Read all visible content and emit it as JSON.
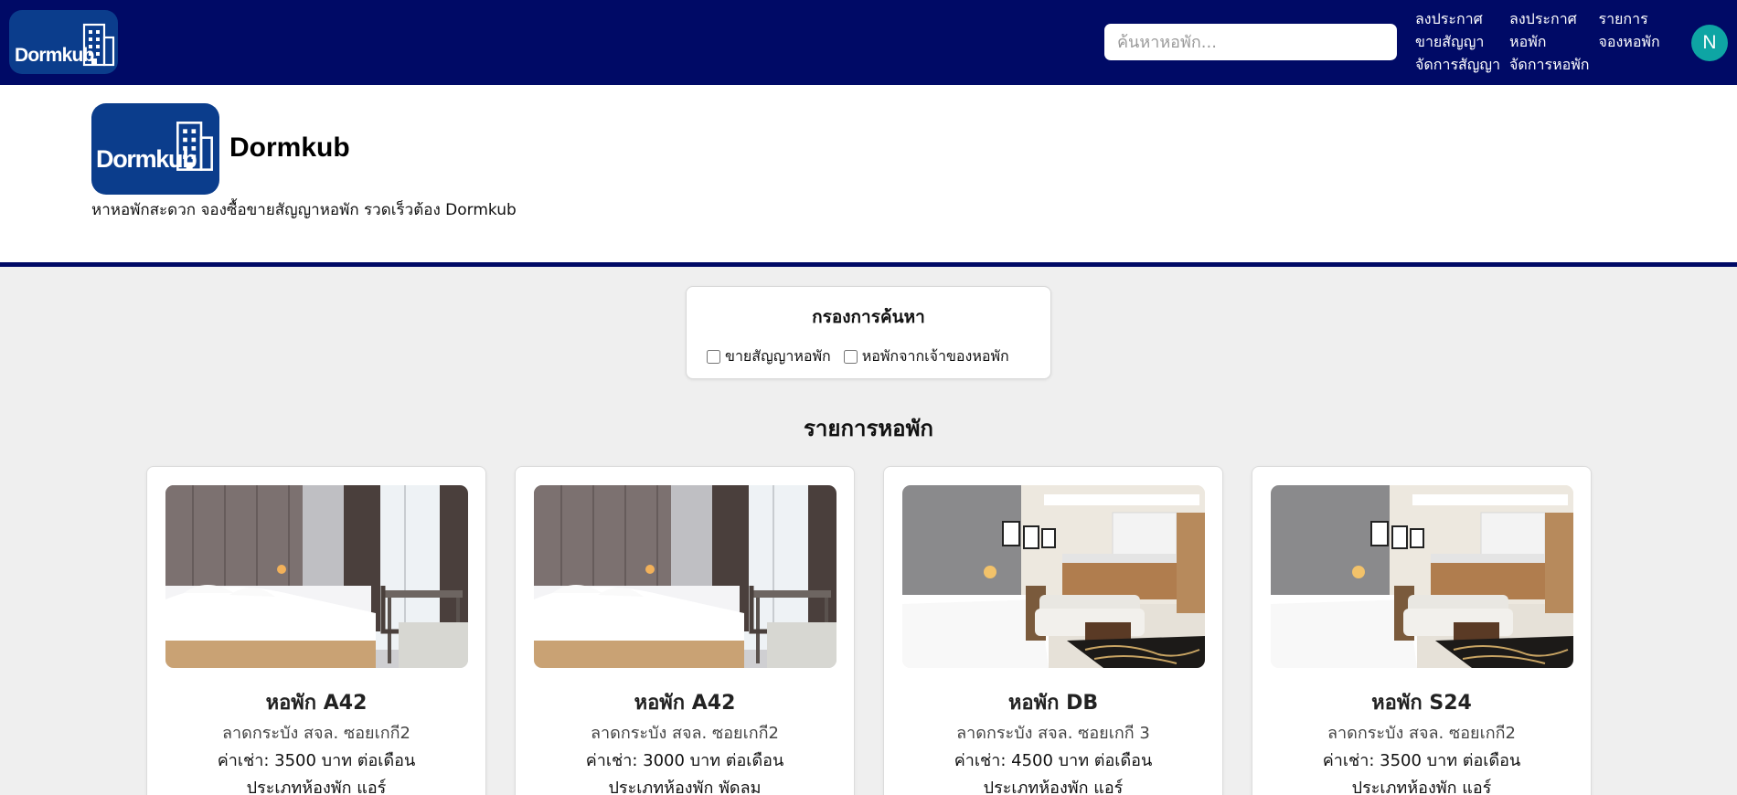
{
  "navbar": {
    "logo_text": "Dormkub",
    "search_placeholder": "ค้นหาหอพัก...",
    "links": [
      {
        "line1": "ลงประกาศ",
        "line2": "ขายสัญญา",
        "line3": "จัดการสัญญา"
      },
      {
        "line1": "ลงประกาศ",
        "line2": "หอพัก",
        "line3": "จัดการหอพัก"
      },
      {
        "line1": "รายการ",
        "line2": "จองหอพัก",
        "line3": ""
      }
    ],
    "avatar_initial": "N"
  },
  "hero": {
    "logo_text": "Dormkub",
    "title": "Dormkub",
    "subtitle": "หาหอพักสะดวก จองซื้อขายสัญญาหอพัก รวดเร็วต้อง Dormkub"
  },
  "filter": {
    "title": "กรองการค้นหา",
    "options": [
      "ขายสัญญาหอพัก",
      "หอพักจากเจ้าของหอพัก"
    ]
  },
  "listing": {
    "title": "รายการหอพัก",
    "cards": [
      {
        "name": "หอพัก A42",
        "address": "ลาดกระบัง สจล. ซอยเกกี2",
        "price": "ค่าเช่า: 3500 บาท ต่อเดือน",
        "room_type": "ประเภทห้องพัก แอร์",
        "image": "bedroom-window-photo"
      },
      {
        "name": "หอพัก A42",
        "address": "ลาดกระบัง สจล. ซอยเกกี2",
        "price": "ค่าเช่า: 3000 บาท ต่อเดือน",
        "room_type": "ประเภทห้องพัก พัดลม",
        "image": "bedroom-window-photo"
      },
      {
        "name": "หอพัก DB",
        "address": "ลาดกระบัง สจล. ซอยเกกี 3",
        "price": "ค่าเช่า: 4500 บาท ต่อเดือน",
        "room_type": "ประเภทห้องพัก แอร์",
        "image": "studio-sofa-kitchen-photo"
      },
      {
        "name": "หอพัก S24",
        "address": "ลาดกระบัง สจล. ซอยเกกี2",
        "price": "ค่าเช่า: 3500 บาท ต่อเดือน",
        "room_type": "ประเภทห้องพัก แอร์",
        "image": "studio-sofa-kitchen-photo"
      }
    ]
  },
  "colors": {
    "navbar_bg": "#000a66",
    "logo_bg": "#0b3d8c",
    "avatar_bg": "#0ea5a4",
    "page_bg": "#efefef"
  }
}
